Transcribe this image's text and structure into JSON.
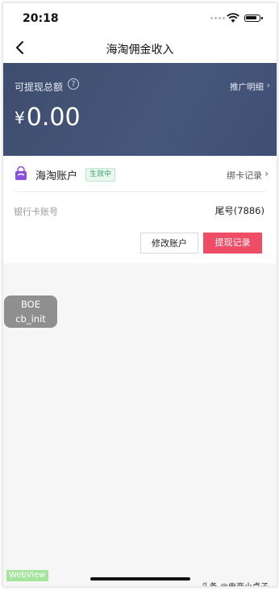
{
  "status_bar": {
    "time": "20:18"
  },
  "nav": {
    "title": "海淘佣金收入"
  },
  "hero": {
    "label": "可提现总额",
    "help": "?",
    "promo_link": "推广明细",
    "currency": "¥",
    "amount": "0.00"
  },
  "account": {
    "name": "海淘账户",
    "status": "生效中",
    "bind_record": "绑卡记录",
    "bank_label": "银行卡账号",
    "bank_value": "尾号(7886)",
    "edit_button": "修改账户",
    "withdraw_button": "提现记录"
  },
  "debug": {
    "line1": "BOE",
    "line2": "cb_init"
  },
  "webview_tag": "WebView",
  "watermark": "头条 @电商小桌子",
  "colors": {
    "hero": "#46577c",
    "accent": "#ee4d66",
    "badge": "#3aa56b"
  }
}
